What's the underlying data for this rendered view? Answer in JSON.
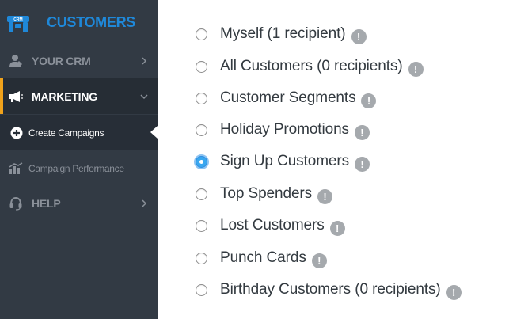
{
  "sidebar": {
    "brand": {
      "title": "CUSTOMERS",
      "icon": "customers-logo-icon",
      "logo_text": "CRM"
    },
    "items": [
      {
        "label": "YOUR CRM",
        "icon": "user-icon"
      },
      {
        "label": "MARKETING",
        "icon": "megaphone-icon"
      },
      {
        "label": "Create Campaigns",
        "icon": "plus-circle-icon"
      },
      {
        "label": "Campaign Performance",
        "icon": "chart-icon"
      },
      {
        "label": "HELP",
        "icon": "headset-icon"
      }
    ],
    "colors": {
      "background": "#323a44",
      "accent": "#f0a21b",
      "brand": "#1f88d9"
    }
  },
  "main": {
    "options": [
      {
        "label": "Myself (1 recipient)",
        "checked": false
      },
      {
        "label": "All Customers (0 recipients)",
        "checked": false
      },
      {
        "label": "Customer Segments",
        "checked": false
      },
      {
        "label": "Holiday Promotions",
        "checked": false
      },
      {
        "label": "Sign Up Customers",
        "checked": true
      },
      {
        "label": "Top Spenders",
        "checked": false
      },
      {
        "label": "Lost Customers",
        "checked": false
      },
      {
        "label": "Punch Cards",
        "checked": false
      },
      {
        "label": "Birthday Customers (0 recipients)",
        "checked": false
      }
    ],
    "info_icon": "!"
  }
}
